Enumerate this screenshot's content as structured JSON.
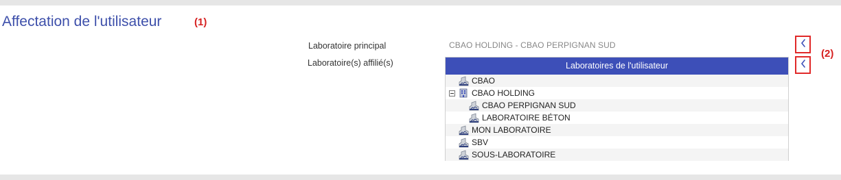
{
  "section": {
    "title": "Affectation de l'utilisateur",
    "annotation_1": "(1)",
    "annotation_2": "(2)"
  },
  "form": {
    "principal_label": "Laboratoire principal",
    "principal_value": "CBAO HOLDING - CBAO PERPIGNAN SUD",
    "affiliated_label": "Laboratoire(s) affilié(s)"
  },
  "tree": {
    "header": "Laboratoires de l'utilisateur",
    "items": [
      {
        "label": "CBAO",
        "icon": "lab-icon",
        "level": 0
      },
      {
        "label": "CBAO HOLDING",
        "icon": "building-icon",
        "level": 0,
        "expanded": true
      },
      {
        "label": "CBAO PERPIGNAN SUD",
        "icon": "lab-icon",
        "level": 1
      },
      {
        "label": "LABORATOIRE BÉTON",
        "icon": "lab-icon",
        "level": 1
      },
      {
        "label": "MON LABORATOIRE",
        "icon": "lab-icon",
        "level": 0
      },
      {
        "label": "SBV",
        "icon": "lab-icon",
        "level": 0
      },
      {
        "label": "SOUS-LABORATOIRE",
        "icon": "lab-icon",
        "level": 0
      }
    ]
  },
  "colors": {
    "accent": "#3d4fb8",
    "title": "#3d4faa",
    "annotation": "#d62020"
  }
}
